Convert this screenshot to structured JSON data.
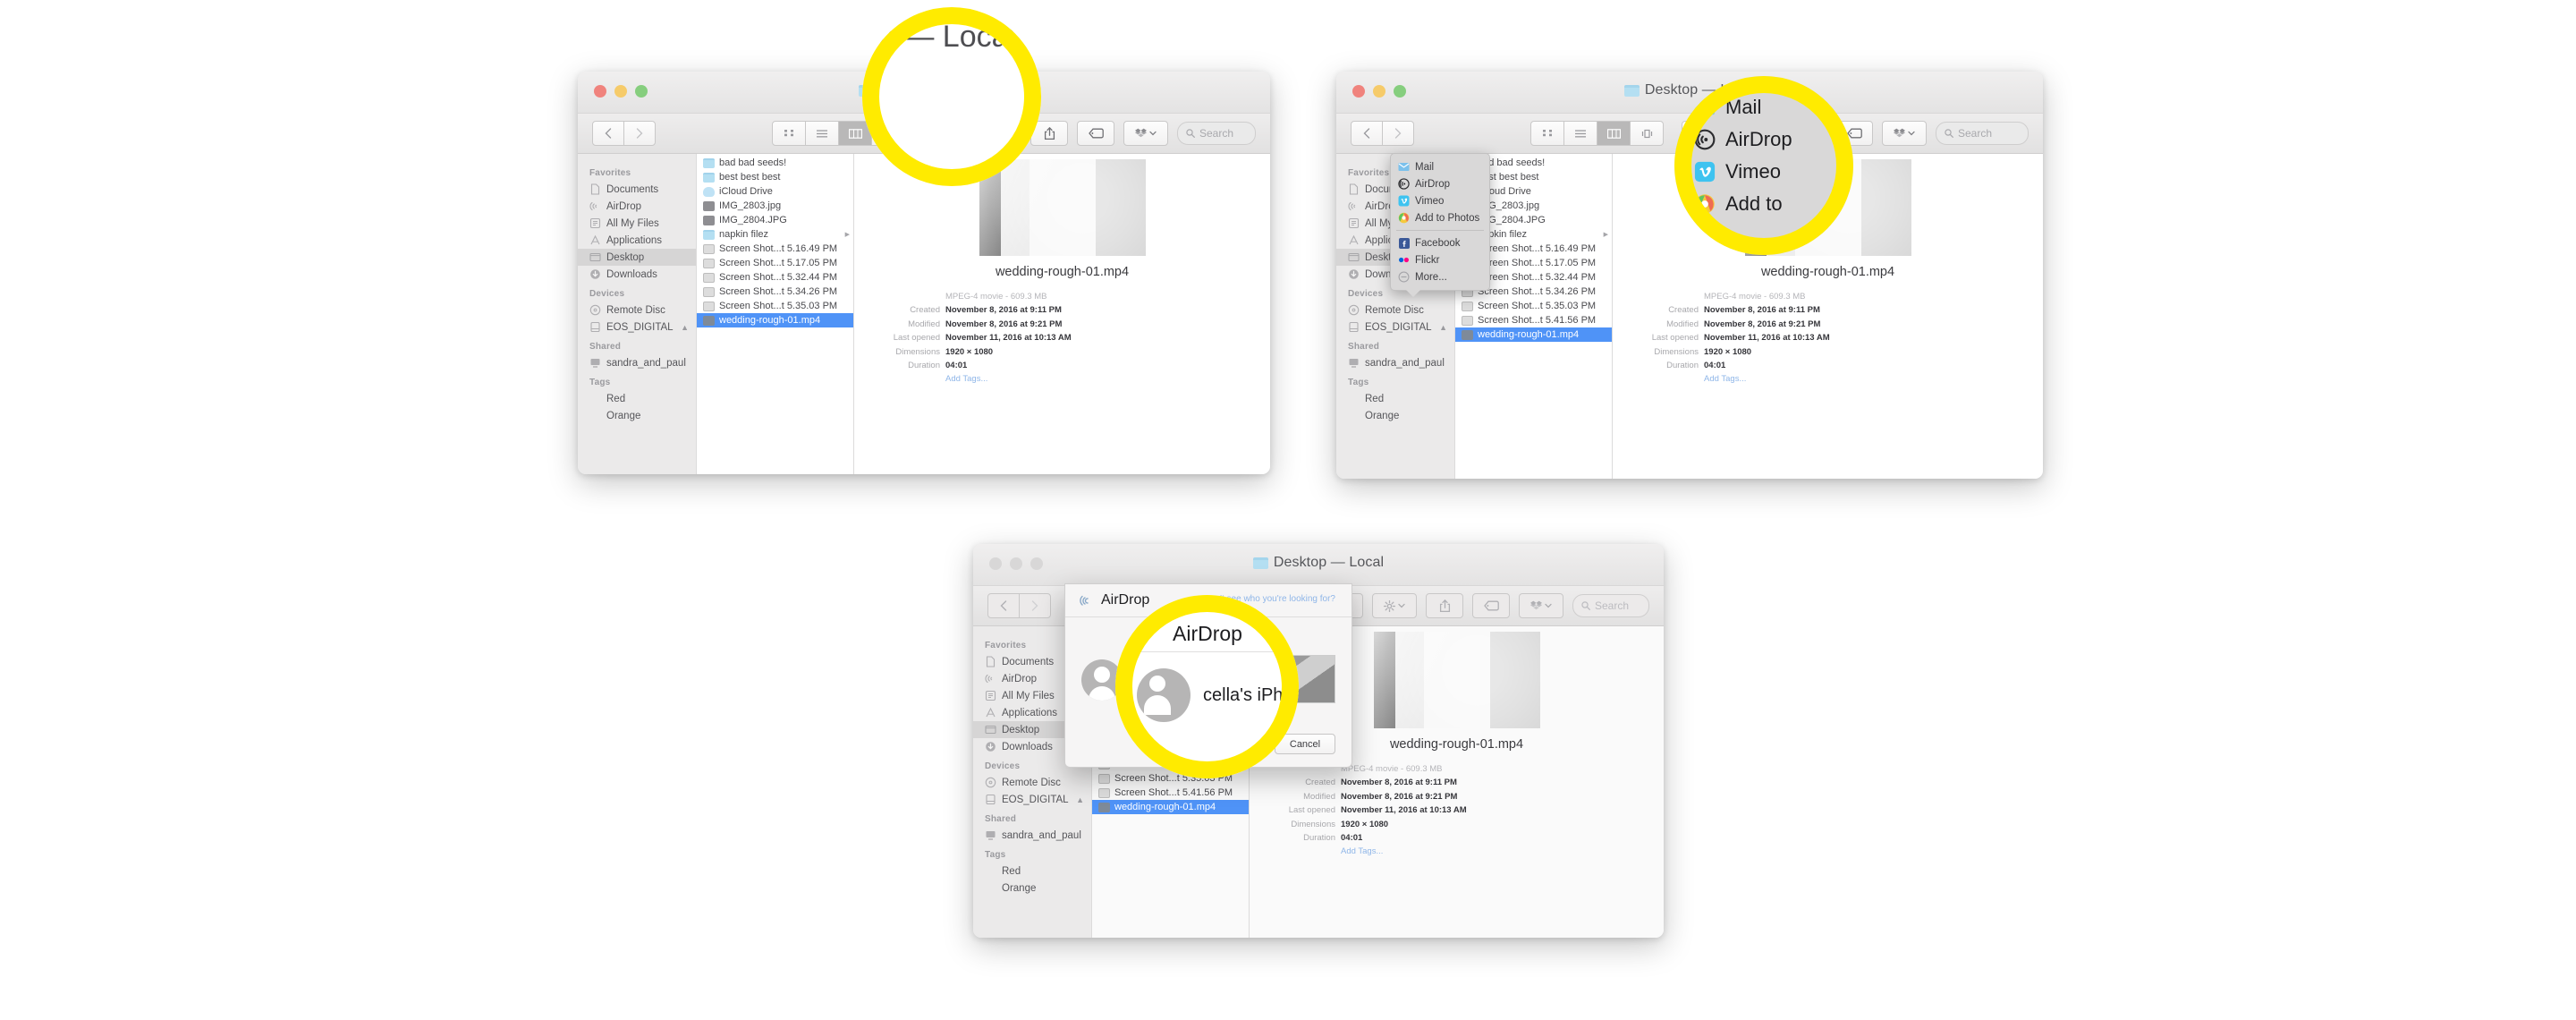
{
  "meta": {
    "accent_yellow": "#ffeb00",
    "selection_blue": "#4f93f7",
    "link_blue": "#8fb6e8"
  },
  "window_title": "Desktop — Local",
  "toolbar": {
    "search_placeholder": "Search",
    "back_label": "Back",
    "forward_label": "Forward",
    "icon_view_label": "Icon View",
    "list_view_label": "List View",
    "column_view_label": "Column View",
    "coverflow_view_label": "Cover Flow View",
    "arrange_label": "Arrange",
    "action_label": "Action",
    "share_label": "Share",
    "tag_label": "Tags",
    "dropbox_label": "Dropbox"
  },
  "sidebar": {
    "sections": [
      {
        "header": "Favorites",
        "items": [
          {
            "label": "Documents",
            "icon": "document-icon"
          },
          {
            "label": "AirDrop",
            "icon": "airdrop-icon"
          },
          {
            "label": "All My Files",
            "icon": "all-my-files-icon"
          },
          {
            "label": "Applications",
            "icon": "applications-icon"
          },
          {
            "label": "Desktop",
            "icon": "desktop-icon",
            "selected": true
          },
          {
            "label": "Downloads",
            "icon": "downloads-icon"
          }
        ]
      },
      {
        "header": "Devices",
        "items": [
          {
            "label": "Remote Disc",
            "icon": "disc-icon"
          },
          {
            "label": "EOS_DIGITAL",
            "icon": "drive-icon",
            "eject": true
          }
        ]
      },
      {
        "header": "Shared",
        "items": [
          {
            "label": "sandra_and_paul",
            "icon": "computer-icon"
          }
        ]
      },
      {
        "header": "Tags",
        "items": [
          {
            "label": "Red",
            "icon": "tag-dot-icon",
            "color": "#f08a84"
          },
          {
            "label": "Orange",
            "icon": "tag-dot-icon",
            "color": "#f4c07a"
          }
        ]
      }
    ]
  },
  "file_list": {
    "window1_items": [
      {
        "name": "bad bad seeds!",
        "icon": "folder-icon"
      },
      {
        "name": "best best best",
        "icon": "folder-icon"
      },
      {
        "name": "iCloud Drive",
        "icon": "cloud-icon"
      },
      {
        "name": "IMG_2803.jpg",
        "icon": "image-icon"
      },
      {
        "name": "IMG_2804.JPG",
        "icon": "image-icon"
      },
      {
        "name": "napkin filez",
        "icon": "folder-icon",
        "disclosure": true
      },
      {
        "name": "Screen Shot...t 5.16.49 PM",
        "icon": "screenshot-icon"
      },
      {
        "name": "Screen Shot...t 5.17.05 PM",
        "icon": "screenshot-icon"
      },
      {
        "name": "Screen Shot...t 5.32.44 PM",
        "icon": "screenshot-icon"
      },
      {
        "name": "Screen Shot...t 5.34.26 PM",
        "icon": "screenshot-icon"
      },
      {
        "name": "Screen Shot...t 5.35.03 PM",
        "icon": "screenshot-icon"
      },
      {
        "name": "wedding-rough-01.mp4",
        "icon": "movie-icon",
        "selected": true
      }
    ],
    "window2_items": [
      {
        "name": "bad bad seeds!",
        "icon": "folder-icon"
      },
      {
        "name": "best best best",
        "icon": "folder-icon"
      },
      {
        "name": "iCloud Drive",
        "icon": "cloud-icon"
      },
      {
        "name": "IMG_2803.jpg",
        "icon": "image-icon"
      },
      {
        "name": "IMG_2804.JPG",
        "icon": "image-icon"
      },
      {
        "name": "napkin filez",
        "icon": "folder-icon",
        "disclosure": true
      },
      {
        "name": "Screen Shot...t 5.16.49 PM",
        "icon": "screenshot-icon"
      },
      {
        "name": "Screen Shot...t 5.17.05 PM",
        "icon": "screenshot-icon"
      },
      {
        "name": "Screen Shot...t 5.32.44 PM",
        "icon": "screenshot-icon"
      },
      {
        "name": "Screen Shot...t 5.34.26 PM",
        "icon": "screenshot-icon"
      },
      {
        "name": "Screen Shot...t 5.35.03 PM",
        "icon": "screenshot-icon"
      },
      {
        "name": "Screen Shot...t 5.41.56 PM",
        "icon": "screenshot-icon"
      },
      {
        "name": "wedding-rough-01.mp4",
        "icon": "movie-icon",
        "selected": true
      }
    ]
  },
  "preview": {
    "file_name": "wedding-rough-01.mp4",
    "kind_label": "",
    "kind_value": "MPEG-4 movie - 609.3 MB",
    "rows": [
      {
        "key": "Created",
        "value": "November 8, 2016 at 9:11 PM"
      },
      {
        "key": "Modified",
        "value": "November 8, 2016 at 9:21 PM"
      },
      {
        "key": "Last opened",
        "value": "November 11, 2016 at 10:13 AM"
      },
      {
        "key": "Dimensions",
        "value": "1920 × 1080"
      },
      {
        "key": "Duration",
        "value": "04:01"
      }
    ],
    "add_tags": "Add Tags..."
  },
  "share_menu": {
    "primary": [
      {
        "label": "Mail",
        "icon": "mail-icon",
        "color": "#6fb9e8"
      },
      {
        "label": "AirDrop",
        "icon": "airdrop-icon",
        "color": "#ffffff"
      },
      {
        "label": "Vimeo",
        "icon": "vimeo-icon",
        "color": "#3ec3f0"
      },
      {
        "label": "Add to Photos",
        "icon": "photos-icon",
        "color": "#f2a93b"
      }
    ],
    "secondary": [
      {
        "label": "Facebook",
        "icon": "facebook-icon",
        "color": "#3b5998"
      },
      {
        "label": "Flickr",
        "icon": "flickr-icon",
        "color": "#ffffff"
      },
      {
        "label": "More...",
        "icon": "more-icon",
        "color": "#cfcfcf"
      }
    ]
  },
  "airdrop_sheet": {
    "title": "AirDrop",
    "help_link": "Don't see who you're looking for?",
    "recipient": "cella's iPhone",
    "cancel_label": "Cancel"
  },
  "zoom_callouts": {
    "window1_title_fragment": "p — Local",
    "window2_menu": [
      "Mail",
      "AirDrop",
      "Vimeo",
      "Add to "
    ],
    "window3_airdrop_title": "AirDrop",
    "window3_recipient_fragment": "cella's iPhon"
  }
}
